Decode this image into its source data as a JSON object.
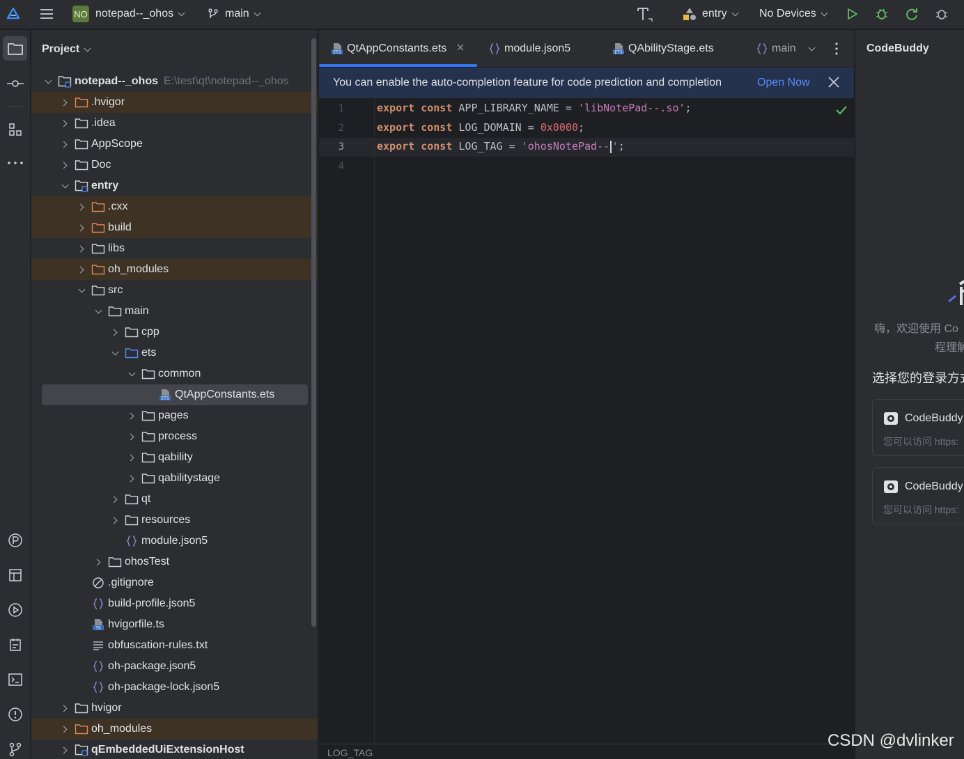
{
  "titlebar": {
    "project_badge": "NO",
    "project_name": "notepad--_ohos",
    "branch": "main",
    "run_config": "entry",
    "device": "No Devices"
  },
  "project_panel": {
    "title": "Project",
    "tree": [
      {
        "label": "notepad--_ohos",
        "path": "E:\\test\\qt\\notepad--_ohos",
        "icon": "module-folder-icon",
        "arrow": "down",
        "level": 0,
        "bold": true
      },
      {
        "label": ".hvigor",
        "icon": "folder-excluded-icon",
        "arrow": "right",
        "level": 1,
        "excluded": true
      },
      {
        "label": ".idea",
        "icon": "folder-icon",
        "arrow": "right",
        "level": 1
      },
      {
        "label": "AppScope",
        "icon": "folder-icon",
        "arrow": "right",
        "level": 1
      },
      {
        "label": "Doc",
        "icon": "folder-icon",
        "arrow": "right",
        "level": 1
      },
      {
        "label": "entry",
        "icon": "module-folder-icon",
        "arrow": "down",
        "level": 1,
        "bold": true
      },
      {
        "label": ".cxx",
        "icon": "folder-excluded-icon",
        "arrow": "right",
        "level": 2,
        "excluded": true
      },
      {
        "label": "build",
        "icon": "folder-excluded-icon",
        "arrow": "right",
        "level": 2,
        "excluded": true
      },
      {
        "label": "libs",
        "icon": "folder-icon",
        "arrow": "right",
        "level": 2
      },
      {
        "label": "oh_modules",
        "icon": "folder-excluded-icon",
        "arrow": "right",
        "level": 2,
        "excluded": true
      },
      {
        "label": "src",
        "icon": "folder-icon",
        "arrow": "down",
        "level": 2
      },
      {
        "label": "main",
        "icon": "folder-icon",
        "arrow": "down",
        "level": 3
      },
      {
        "label": "cpp",
        "icon": "folder-icon",
        "arrow": "right",
        "level": 4
      },
      {
        "label": "ets",
        "icon": "source-folder-icon",
        "arrow": "down",
        "level": 4
      },
      {
        "label": "common",
        "icon": "folder-icon",
        "arrow": "down",
        "level": 5
      },
      {
        "label": "QtAppConstants.ets",
        "icon": "ets-file-icon",
        "arrow": "none",
        "level": 6,
        "selected": true
      },
      {
        "label": "pages",
        "icon": "folder-icon",
        "arrow": "right",
        "level": 5
      },
      {
        "label": "process",
        "icon": "folder-icon",
        "arrow": "right",
        "level": 5
      },
      {
        "label": "qability",
        "icon": "folder-icon",
        "arrow": "right",
        "level": 5
      },
      {
        "label": "qabilitystage",
        "icon": "folder-icon",
        "arrow": "right",
        "level": 5
      },
      {
        "label": "qt",
        "icon": "folder-icon",
        "arrow": "right",
        "level": 4
      },
      {
        "label": "resources",
        "icon": "folder-icon",
        "arrow": "right",
        "level": 4
      },
      {
        "label": "module.json5",
        "icon": "json-file-icon",
        "arrow": "none",
        "level": 4
      },
      {
        "label": "ohosTest",
        "icon": "folder-icon",
        "arrow": "right",
        "level": 3
      },
      {
        "label": ".gitignore",
        "icon": "gitignore-file-icon",
        "arrow": "none",
        "level": 2
      },
      {
        "label": "build-profile.json5",
        "icon": "json-file-icon",
        "arrow": "none",
        "level": 2
      },
      {
        "label": "hvigorfile.ts",
        "icon": "ts-file-icon",
        "arrow": "none",
        "level": 2
      },
      {
        "label": "obfuscation-rules.txt",
        "icon": "text-file-icon",
        "arrow": "none",
        "level": 2
      },
      {
        "label": "oh-package.json5",
        "icon": "json-file-icon",
        "arrow": "none",
        "level": 2
      },
      {
        "label": "oh-package-lock.json5",
        "icon": "json-file-icon",
        "arrow": "none",
        "level": 2
      },
      {
        "label": "hvigor",
        "icon": "folder-icon",
        "arrow": "right",
        "level": 1
      },
      {
        "label": "oh_modules",
        "icon": "folder-excluded-icon",
        "arrow": "right",
        "level": 1,
        "excluded": true
      },
      {
        "label": "qEmbeddedUiExtensionHost",
        "icon": "module-folder-icon",
        "arrow": "right",
        "level": 1,
        "bold": true
      }
    ]
  },
  "editor": {
    "tabs": [
      {
        "label": "QtAppConstants.ets",
        "icon": "ets-file-icon",
        "active": true,
        "closable": true
      },
      {
        "label": "module.json5",
        "icon": "json-file-icon"
      },
      {
        "label": "QAbilityStage.ets",
        "icon": "ets-file-icon"
      },
      {
        "label": "main",
        "icon": "json-file-icon"
      }
    ],
    "banner": {
      "message": "You can enable the auto-completion feature for code prediction and completion",
      "action": "Open Now"
    },
    "lines": [
      {
        "num": "1",
        "tokens": [
          [
            "kw",
            "export"
          ],
          [
            "t",
            " "
          ],
          [
            "kw",
            "const"
          ],
          [
            "t",
            " APP_LIBRARY_NAME = "
          ],
          [
            "str",
            "'libNotePad--.so'"
          ],
          [
            "t",
            ";"
          ]
        ]
      },
      {
        "num": "2",
        "tokens": [
          [
            "kw",
            "export"
          ],
          [
            "t",
            " "
          ],
          [
            "kw",
            "const"
          ],
          [
            "t",
            " LOG_DOMAIN = "
          ],
          [
            "num",
            "0x0000"
          ],
          [
            "t",
            ";"
          ]
        ]
      },
      {
        "num": "3",
        "tokens": [
          [
            "kw",
            "export"
          ],
          [
            "t",
            " "
          ],
          [
            "kw",
            "const"
          ],
          [
            "t",
            " LOG_TAG = "
          ],
          [
            "str",
            "'ohosNotePad--"
          ],
          [
            "caret",
            ""
          ],
          [
            "str",
            "'"
          ],
          [
            "t",
            ";"
          ]
        ]
      },
      {
        "num": "4",
        "tokens": []
      }
    ],
    "current_line": "3",
    "breadcrumb": "LOG_TAG"
  },
  "codebuddy": {
    "title": "CodeBuddy",
    "welcome_line1": "嗨，欢迎使用 Co",
    "welcome_line2": "程理解",
    "choose_login": "选择您的登录方式",
    "cards": [
      {
        "name": "CodeBuddy",
        "sub": "您可以访问 https:"
      },
      {
        "name": "CodeBuddy",
        "sub": "您可以访问 https:"
      }
    ]
  },
  "watermark": "CSDN @dvlinker",
  "colors": {
    "accent": "#3574f0",
    "keyword": "#cf8e6d",
    "string": "#c77dbb",
    "number": "#e06c75",
    "excluded_bg": "#3d3223"
  }
}
